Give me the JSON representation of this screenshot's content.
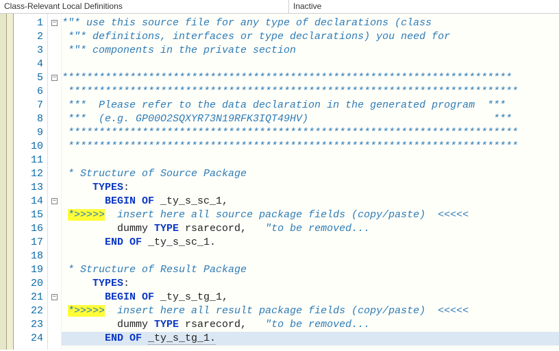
{
  "header": {
    "left": "Class-Relevant Local Definitions",
    "right": "Inactive"
  },
  "lines": [
    {
      "n": 1,
      "fold": "minus",
      "spans": [
        {
          "t": "*\"* use this source file for any type of declarations (class",
          "c": "cm"
        }
      ]
    },
    {
      "n": 2,
      "spans": [
        {
          "t": " *\"* definitions, interfaces or type declarations) you need for",
          "c": "cm"
        }
      ]
    },
    {
      "n": 3,
      "spans": [
        {
          "t": " *\"* components in the private section",
          "c": "cm"
        }
      ]
    },
    {
      "n": 4,
      "spans": []
    },
    {
      "n": 5,
      "fold": "minus",
      "spans": [
        {
          "t": "*************************************************************************",
          "c": "cm"
        }
      ]
    },
    {
      "n": 6,
      "spans": [
        {
          "t": " *************************************************************************",
          "c": "cm"
        }
      ]
    },
    {
      "n": 7,
      "spans": [
        {
          "t": " ***  Please refer to the data declaration in the generated program  ***",
          "c": "cm"
        }
      ]
    },
    {
      "n": 8,
      "spans": [
        {
          "t": " ***  (e.g. GP00O2SQXYR73N19RFK3IQT49HV)                              ***",
          "c": "cm"
        }
      ]
    },
    {
      "n": 9,
      "spans": [
        {
          "t": " *************************************************************************",
          "c": "cm"
        }
      ]
    },
    {
      "n": 10,
      "spans": [
        {
          "t": " *************************************************************************",
          "c": "cm"
        }
      ]
    },
    {
      "n": 11,
      "spans": []
    },
    {
      "n": 12,
      "spans": [
        {
          "t": " * Structure of Source Package",
          "c": "cm"
        }
      ]
    },
    {
      "n": 13,
      "spans": [
        {
          "t": "     ",
          "c": "id"
        },
        {
          "t": "TYPES",
          "c": "kw"
        },
        {
          "t": ":",
          "c": "id"
        }
      ]
    },
    {
      "n": 14,
      "fold": "minus",
      "spans": [
        {
          "t": "       ",
          "c": "id"
        },
        {
          "t": "BEGIN OF",
          "c": "kw"
        },
        {
          "t": " _ty_s_sc_1,",
          "c": "id"
        }
      ]
    },
    {
      "n": 15,
      "spans": [
        {
          "t": " ",
          "c": "id"
        },
        {
          "t": "*>>>>>",
          "c": "cm hl"
        },
        {
          "t": "  insert here all source package fields (copy/paste)  <<<<<",
          "c": "cm"
        }
      ]
    },
    {
      "n": 16,
      "spans": [
        {
          "t": "         dummy ",
          "c": "id"
        },
        {
          "t": "TYPE",
          "c": "kw"
        },
        {
          "t": " rsarecord,   ",
          "c": "id"
        },
        {
          "t": "\"to be removed...",
          "c": "cm"
        }
      ]
    },
    {
      "n": 17,
      "spans": [
        {
          "t": "       ",
          "c": "id"
        },
        {
          "t": "END OF",
          "c": "kw"
        },
        {
          "t": " _ty_s_sc_1.",
          "c": "id"
        }
      ]
    },
    {
      "n": 18,
      "spans": []
    },
    {
      "n": 19,
      "spans": [
        {
          "t": " * Structure of Result Package",
          "c": "cm"
        }
      ]
    },
    {
      "n": 20,
      "spans": [
        {
          "t": "     ",
          "c": "id"
        },
        {
          "t": "TYPES",
          "c": "kw"
        },
        {
          "t": ":",
          "c": "id"
        }
      ]
    },
    {
      "n": 21,
      "fold": "minus",
      "spans": [
        {
          "t": "       ",
          "c": "id"
        },
        {
          "t": "BEGIN OF",
          "c": "kw"
        },
        {
          "t": " _ty_s_tg_1,",
          "c": "id"
        }
      ]
    },
    {
      "n": 22,
      "spans": [
        {
          "t": " ",
          "c": "id"
        },
        {
          "t": "*>>>>>",
          "c": "cm hl"
        },
        {
          "t": "  insert here all result package fields (copy/paste)  <<<<<",
          "c": "cm"
        }
      ]
    },
    {
      "n": 23,
      "spans": [
        {
          "t": "         dummy ",
          "c": "id"
        },
        {
          "t": "TYPE",
          "c": "kw"
        },
        {
          "t": " rsarecord,   ",
          "c": "id"
        },
        {
          "t": "\"to be removed...",
          "c": "cm"
        }
      ]
    },
    {
      "n": 24,
      "selected": true,
      "spans": [
        {
          "t": "       ",
          "c": "id"
        },
        {
          "t": "END OF",
          "c": "kw"
        },
        {
          "t": " ",
          "c": "id"
        },
        {
          "t": "_ty_s_tg_1.",
          "c": "id dotted"
        }
      ]
    }
  ]
}
